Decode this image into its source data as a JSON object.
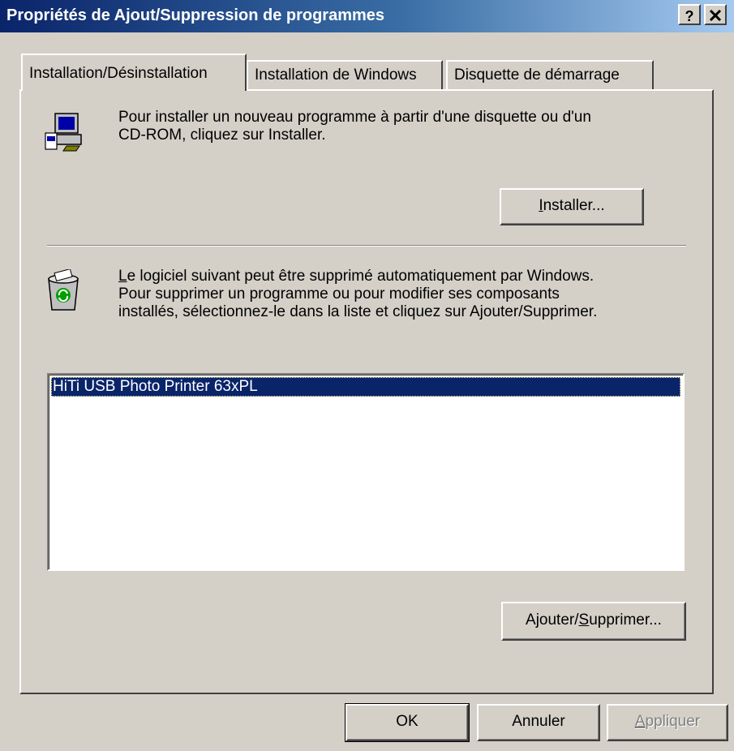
{
  "window": {
    "title": "Propriétés de Ajout/Suppression de programmes",
    "help_button": "?",
    "close_button": "×"
  },
  "tabs": [
    {
      "label": "Installation/Désinstallation",
      "active": true
    },
    {
      "label": "Installation de Windows",
      "active": false
    },
    {
      "label": "Disquette de démarrage",
      "active": false
    }
  ],
  "install_section": {
    "text_line1": "Pour installer un nouveau programme à partir d'une disquette ou d'un",
    "text_line2": "CD-ROM, cliquez sur Installer.",
    "button_accel": "I",
    "button_rest": "nstaller...",
    "icon": "computer-install-icon"
  },
  "remove_section": {
    "line1_accel": "L",
    "line1_rest": "e logiciel suivant peut être supprimé automatiquement par Windows.",
    "line2": "Pour supprimer un programme ou pour modifier ses composants",
    "line3": "installés, sélectionnez-le dans la liste et cliquez sur Ajouter/Supprimer.",
    "icon": "recycle-bin-icon"
  },
  "program_list": {
    "items": [
      {
        "label": "HiTi USB Photo Printer 63xPL",
        "selected": true
      }
    ]
  },
  "add_remove_button": {
    "prefix": "Ajouter/",
    "accel": "S",
    "rest": "upprimer..."
  },
  "footer": {
    "ok": "OK",
    "cancel": "Annuler",
    "apply_accel": "A",
    "apply_rest": "ppliquer",
    "apply_enabled": false
  },
  "colors": {
    "face": "#d4d0c8",
    "title_start": "#0a246a",
    "title_end": "#a6caf0",
    "selection": "#0a246a"
  }
}
